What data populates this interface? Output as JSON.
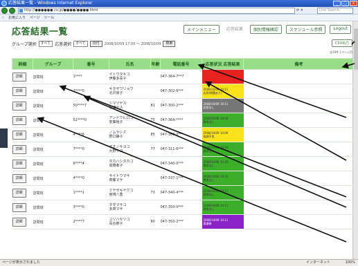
{
  "browser": {
    "title": "応答結果一覧 - Windows Internet Explorer",
    "url": "http://●●●●●●.co.jp/●●●●/●●●●.html",
    "search_placeholder": "Live Search",
    "toolbar_items": [
      "☆",
      "お気に入り",
      "ページ",
      "ツール"
    ],
    "status_left": "ページが表示されました",
    "status_zone": "インターネット",
    "status_zoom": "100%"
  },
  "page": {
    "title": "応答結果一覧",
    "links": [
      "メインメニュー",
      "応答結果",
      "個別情報確認",
      "スケジュール参照",
      "Logout"
    ],
    "filter": {
      "group_label": "グループ選択",
      "group_value": "すべて",
      "status_label": "応答選択",
      "status_value": "すべて",
      "date_button": "日付",
      "range_text": "2008/10/09 17:00 ～ 2008/10/09",
      "search_button": "検索"
    },
    "csv_button": "CSV出力",
    "count_note": "全19件 1ページ目"
  },
  "table": {
    "headers": [
      "詳細",
      "グループ",
      "番号",
      "氏名",
      "年齢",
      "電話番号",
      "応答状況 応答結果",
      "備考"
    ],
    "rows": [
      {
        "detail": "詳細",
        "group": "訪問班",
        "no": "1****",
        "name": "イトウタキコ\n伊藤多喜子",
        "age": "",
        "tel": "047-364-7**7",
        "status": "",
        "color": "#e8221f"
      },
      {
        "detail": "詳細",
        "group": "訪問班",
        "no": "2****0",
        "name": "キタザワリョウ\n北沢良子",
        "age": "",
        "tel": "047-302-6***",
        "status": "2008/10/09 10:11\n応答(問題あり)",
        "color": "#f8e21a"
      },
      {
        "detail": "詳細",
        "group": "訪問班",
        "no": "50****7",
        "name": "シマヅヤス\n島津ヤス",
        "age": "81",
        "tel": "047-300-2***",
        "status": "2008/10/09 10:11\n応答なし",
        "color": "#777777"
      },
      {
        "detail": "詳細",
        "group": "訪問班",
        "no": "52****0",
        "name": "アンドウヒロコ\n安藤裕子",
        "age": "75",
        "tel": "047-364-****",
        "status": "2008/10/09 10:09\n異常なし",
        "color": "#3cae2a"
      },
      {
        "detail": "詳細",
        "group": "訪問班",
        "no": "4****6",
        "name": "ノムラシズ\n野口静子",
        "age": "85",
        "tel": "047-360-2***",
        "status": "2008/10/09 10:09\n体調不良",
        "color": "#f8e21a"
      },
      {
        "detail": "詳細",
        "group": "訪問班",
        "no": "7****0",
        "name": "オオノサヨコ\n大野サヨ",
        "age": "77",
        "tel": "047-311-6***",
        "status": "2008/10/09 10:10\n異常なし",
        "color": "#3cae2a"
      },
      {
        "detail": "詳細",
        "group": "訪問班",
        "no": "6****4",
        "name": "タカハシタカコ\n高橋孝子",
        "age": "",
        "tel": "047-340-0***",
        "status": "2008/10/09 10:10\n異常なし",
        "color": "#3cae2a"
      },
      {
        "detail": "詳細",
        "group": "訪問班",
        "no": "4****0",
        "name": "サイトウマサ\n斉藤マサ",
        "age": "",
        "tel": "047-337-1***",
        "status": "2008/10/09 10:10\n異常なし",
        "color": "#3cae2a"
      },
      {
        "detail": "詳細",
        "group": "訪問班",
        "no": "1****1",
        "name": "ミヤザキヤクコ\n宮崎八重",
        "age": "73",
        "tel": "047-340-4***",
        "status": "2008/10/09 10:11\n異常なし",
        "color": "#3cae2a"
      },
      {
        "detail": "詳細",
        "group": "訪問班",
        "no": "3****0",
        "name": "タダマサコ\n多田マサ",
        "age": "",
        "tel": "047-350-0***",
        "status": "2008/10/09 10:11\n異常なし",
        "color": "#3cae2a"
      },
      {
        "detail": "詳細",
        "group": "訪問班",
        "no": "2****7",
        "name": "ユリハセツコ\n百合節子",
        "age": "80",
        "tel": "047-350-2***",
        "status": "2008/10/09 10:11\n要連絡",
        "color": "#8a22c8"
      }
    ]
  },
  "colors": {
    "header_bg": "#99dd88",
    "title_green": "#2e6e2e"
  }
}
